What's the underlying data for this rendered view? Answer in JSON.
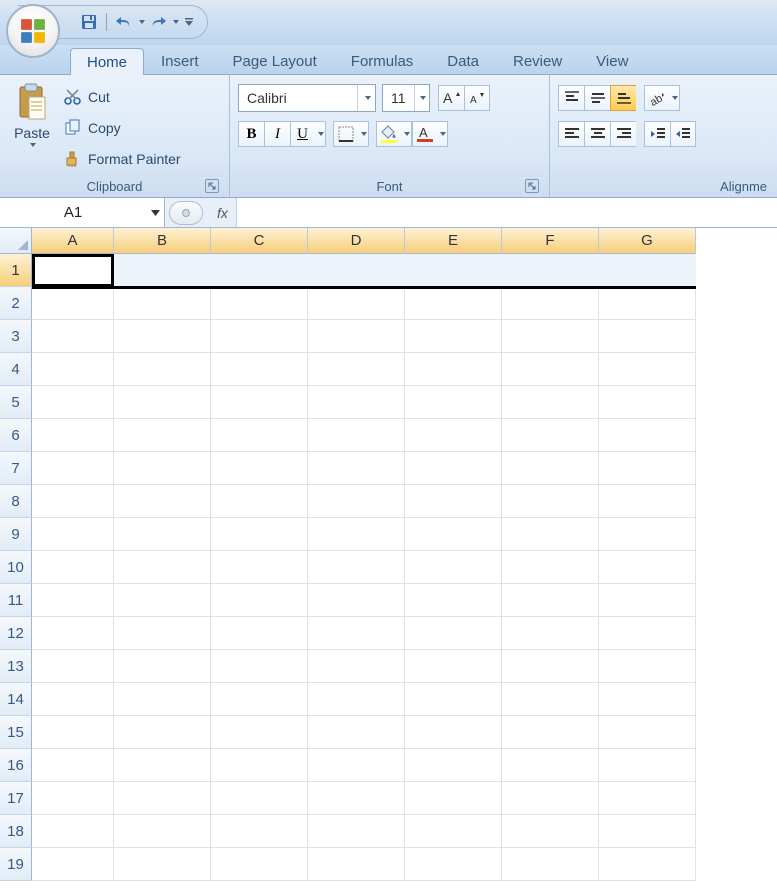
{
  "qat": {
    "save": "save-icon",
    "undo": "undo-icon",
    "redo": "redo-icon"
  },
  "tabs": [
    "Home",
    "Insert",
    "Page Layout",
    "Formulas",
    "Data",
    "Review",
    "View"
  ],
  "active_tab": "Home",
  "clipboard": {
    "paste": "Paste",
    "cut": "Cut",
    "copy": "Copy",
    "format_painter": "Format Painter",
    "label": "Clipboard"
  },
  "font": {
    "name": "Calibri",
    "size": "11",
    "label": "Font"
  },
  "alignment": {
    "label": "Alignme"
  },
  "namebox": "A1",
  "fx": "fx",
  "columns": [
    "A",
    "B",
    "C",
    "D",
    "E",
    "F",
    "G"
  ],
  "rows": [
    "1",
    "2",
    "3",
    "4",
    "5",
    "6",
    "7",
    "8",
    "9",
    "10",
    "11",
    "12",
    "13",
    "14",
    "15",
    "16",
    "17",
    "18",
    "19"
  ]
}
